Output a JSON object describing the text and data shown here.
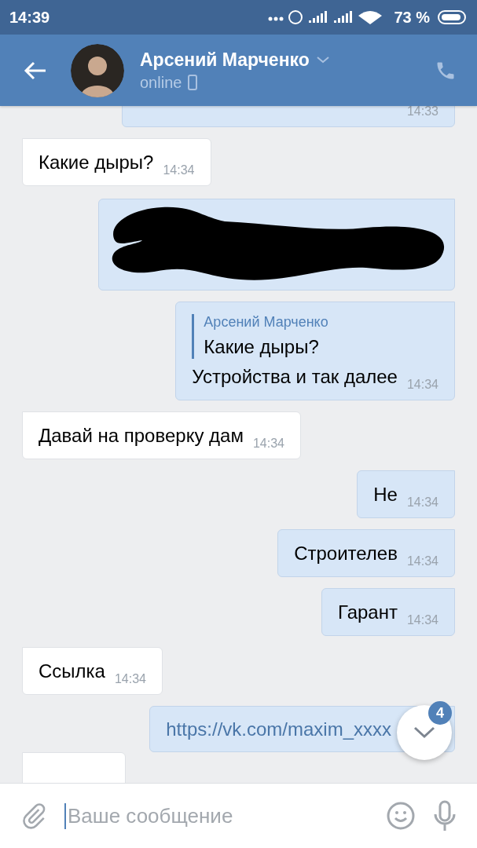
{
  "status_bar": {
    "time": "14:39",
    "battery": "73 %"
  },
  "header": {
    "name": "Арсений Марченко",
    "status": "online"
  },
  "messages": [
    {
      "kind": "clipped",
      "outgoing": true,
      "time": "14:33"
    },
    {
      "kind": "text",
      "outgoing": false,
      "text": "Какие дыры?",
      "time": "14:34"
    },
    {
      "kind": "redacted",
      "outgoing": true
    },
    {
      "kind": "reply",
      "outgoing": true,
      "quote_author": "Арсений Марченко",
      "quote_text": "Какие дыры?",
      "text": "Устройства и так далее",
      "time": "14:34"
    },
    {
      "kind": "text",
      "outgoing": false,
      "text": "Давай на проверку дам",
      "time": "14:34"
    },
    {
      "kind": "text",
      "outgoing": true,
      "text": "Не",
      "time": "14:34"
    },
    {
      "kind": "text",
      "outgoing": true,
      "text": "Строителев",
      "time": "14:34"
    },
    {
      "kind": "text",
      "outgoing": true,
      "text": "Гарант",
      "time": "14:34"
    },
    {
      "kind": "text",
      "outgoing": false,
      "text": "Ссылка",
      "time": "14:34"
    },
    {
      "kind": "link",
      "outgoing": true,
      "text": "https://vk.com/maxim_xxxx"
    },
    {
      "kind": "clipped",
      "outgoing": false
    }
  ],
  "scroll_button": {
    "badge": "4"
  },
  "composer": {
    "placeholder": "Ваше сообщение"
  }
}
